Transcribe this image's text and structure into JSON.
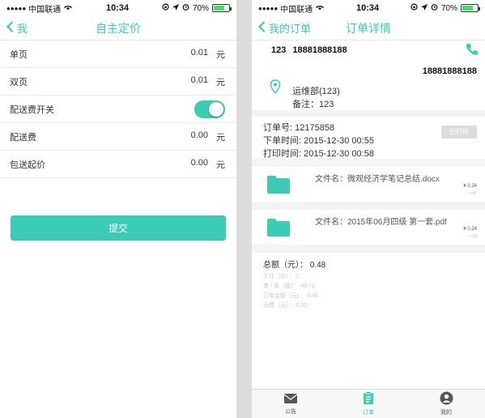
{
  "status": {
    "carrier": "中国联通",
    "time": "10:34",
    "battery": "70%"
  },
  "left": {
    "nav": {
      "back_label": "我",
      "title": "自主定价"
    },
    "rows": [
      {
        "label": "单页",
        "value": "0.01",
        "unit": "元"
      },
      {
        "label": "双页",
        "value": "0.01",
        "unit": "元"
      },
      {
        "label": "配送费开关",
        "toggle": true
      },
      {
        "label": "配送费",
        "value": "0.00",
        "unit": "元"
      },
      {
        "label": "包送起价",
        "value": "0.00",
        "unit": "元"
      }
    ],
    "submit_label": "提交"
  },
  "right": {
    "nav": {
      "back_label": "我的订单",
      "title": "订单详情"
    },
    "contact": {
      "name": "123",
      "phone": "18881888188"
    },
    "address": {
      "phone": "18881888188",
      "dept": "运维部(123)",
      "note": "备注：123"
    },
    "order": {
      "number": "订单号: 12175858",
      "order_time": "下单时间: 2015-12-30 00:55",
      "print_time": "打印时间: 2015-12-30 00:58",
      "printed_label": "已打印"
    },
    "files": [
      {
        "name": "文件名：微观经济学笔记总结.docx",
        "price": "¥ 0.24",
        "detail": "x 47"
      },
      {
        "name": "文件名：2015年06月四级 第一套.pdf",
        "price": "¥ 0.24",
        "detail": "x 24"
      }
    ],
    "totals": {
      "total": "总额（元）：  0.48",
      "lines": [
        "文件（份）：  2",
        "单 / 双（面）：  48 / 0",
        "订单金额（元）：  0.48",
        "运费（元）：  0.00"
      ]
    },
    "tabs": [
      {
        "label": "公告",
        "icon": "envelope-icon",
        "active": false
      },
      {
        "label": "订单",
        "icon": "clipboard-icon",
        "active": true
      },
      {
        "label": "我的",
        "icon": "user-icon",
        "active": false
      }
    ]
  },
  "colors": {
    "accent": "#3ccbb5",
    "battery": "#4cd964",
    "divider": "#ececec"
  }
}
